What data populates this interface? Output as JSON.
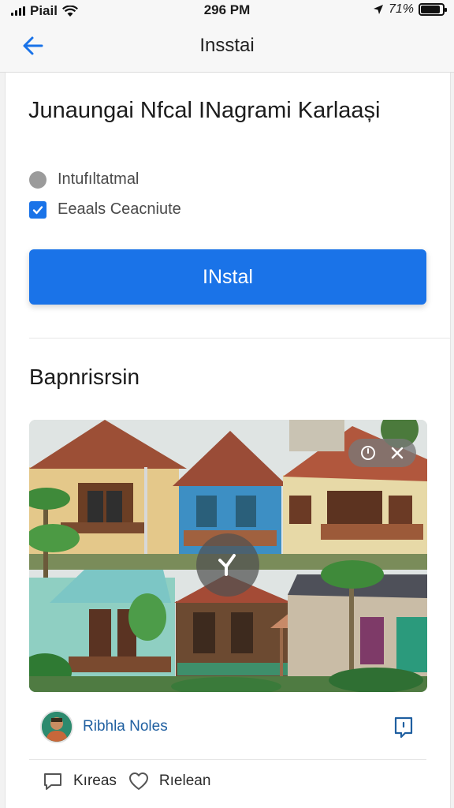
{
  "status_bar": {
    "carrier": "Piail",
    "time": "296 PM",
    "battery_text": "71%",
    "battery_level": 0.9
  },
  "nav": {
    "title": "Insstai"
  },
  "card": {
    "title": "Junaungai Nfcal INagrami Karlaași",
    "options": [
      {
        "label": "Intufıltatmal",
        "checked": false
      },
      {
        "label": "Eeaals Ceacniute",
        "checked": true
      }
    ],
    "install_label": "INstal",
    "section_title": "Bapnrisrsin"
  },
  "author": {
    "name": "Ribhla Noles"
  },
  "actions": {
    "comments_label": "Kıreas",
    "likes_label": "Rıelean"
  },
  "colors": {
    "accent": "#1a73e8",
    "link": "#1f5fa0"
  }
}
